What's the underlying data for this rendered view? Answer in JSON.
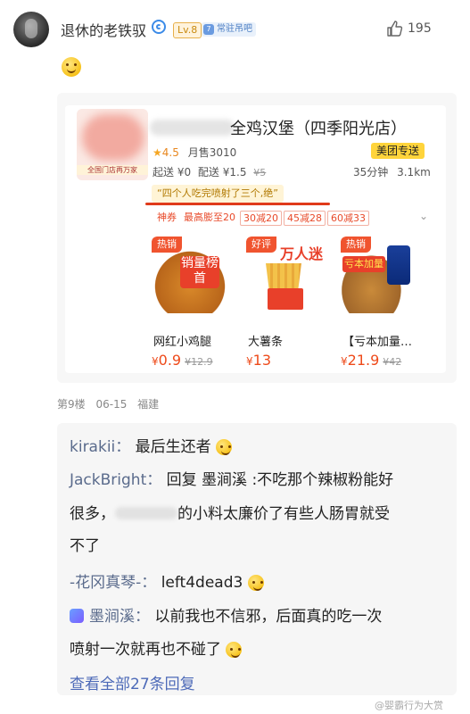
{
  "post": {
    "username": "退休的老铁驭",
    "level": "Lv.8",
    "badge_num": "7",
    "badge_text": "常驻吊吧",
    "like_count": "195",
    "floor": "第9楼",
    "date": "06-15",
    "location": "福建"
  },
  "shop": {
    "name": "全鸡汉堡（四季阳光店）",
    "logo_caption": "全国门店再万家",
    "rating": "4.5",
    "monthly_sales": "月售3010",
    "delivery_start": "起送 ¥0",
    "delivery_fee": "配送 ¥1.5",
    "delivery_fee_old": "¥5",
    "service": "美团专送",
    "time": "35分钟",
    "distance": "3.1km",
    "quote": "“四个人吃完喷射了三个,绝”",
    "promos": [
      "神券",
      "最高膨至20",
      "30减20",
      "45减28",
      "60减33"
    ],
    "products": [
      {
        "tag": "热销",
        "tag_color": "#f0542f",
        "overlay": "销量榜首",
        "name": "网红小鸡腿",
        "price": "0.9",
        "old_price": "¥12.9"
      },
      {
        "tag": "好评",
        "tag_color": "#f0542f",
        "overlay": "万人迷",
        "name": "大薯条",
        "price": "13",
        "old_price": ""
      },
      {
        "tag": "热销",
        "tag_color": "#f0542f",
        "overlay": "亏本加量",
        "name": "【亏本加量…",
        "price": "21.9",
        "old_price": "¥42"
      }
    ]
  },
  "replies": {
    "r1_name": "kirakii",
    "r1_text": "最后生还者",
    "r2_name": "JackBright",
    "r2_text": "回复 墨涧溪 :不吃那个辣椒粉能好",
    "r2_line2a": "很多，",
    "r2_line2b": "的小料太廉价了有些人肠胃就受",
    "r2_line3": "不了",
    "r3_name": "-花冈真琴-",
    "r3_text": "left4dead3",
    "r4_name": "墨涧溪",
    "r4_text": "以前我也不信邪，后面真的吃一次",
    "r4_line2": "喷射一次就再也不碰了",
    "more": "查看全部27条回复"
  },
  "watermark": "@婴霸行为大赏",
  "colors": {
    "accent_red": "#ee4a1a",
    "link_blue": "#4d6ab8",
    "meituan_yellow": "#ffd43b"
  }
}
